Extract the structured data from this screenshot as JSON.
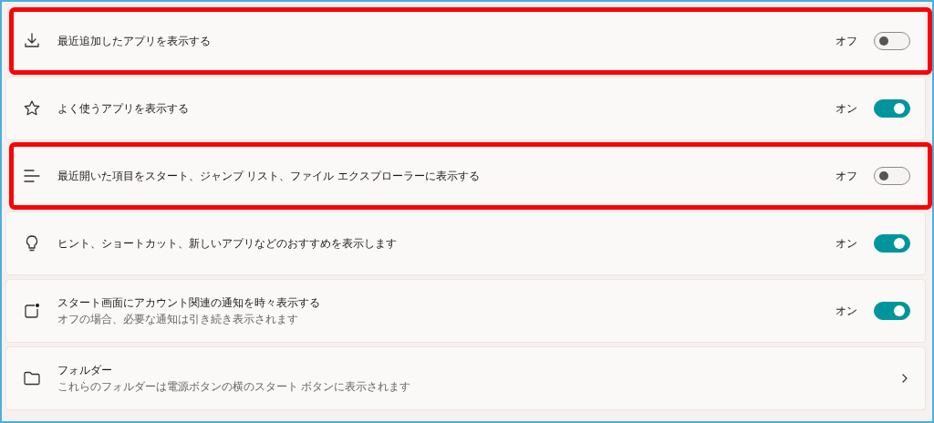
{
  "settings": [
    {
      "kind": "toggle",
      "title": "最近追加したアプリを表示する",
      "state_label": "オフ",
      "on": false,
      "highlighted": true
    },
    {
      "kind": "toggle",
      "title": "よく使うアプリを表示する",
      "state_label": "オン",
      "on": true,
      "highlighted": false
    },
    {
      "kind": "toggle",
      "title": "最近開いた項目をスタート、ジャンプ リスト、ファイル エクスプローラーに表示する",
      "state_label": "オフ",
      "on": false,
      "highlighted": true
    },
    {
      "kind": "toggle",
      "title": "ヒント、ショートカット、新しいアプリなどのおすすめを表示します",
      "state_label": "オン",
      "on": true,
      "highlighted": false
    },
    {
      "kind": "toggle",
      "title": "スタート画面にアカウント関連の通知を時々表示する",
      "subtitle": "オフの場合、必要な通知は引き続き表示されます",
      "state_label": "オン",
      "on": true,
      "highlighted": false
    },
    {
      "kind": "link",
      "title": "フォルダー",
      "subtitle": "これらのフォルダーは電源ボタンの横のスタート ボタンに表示されます",
      "highlighted": false
    }
  ]
}
